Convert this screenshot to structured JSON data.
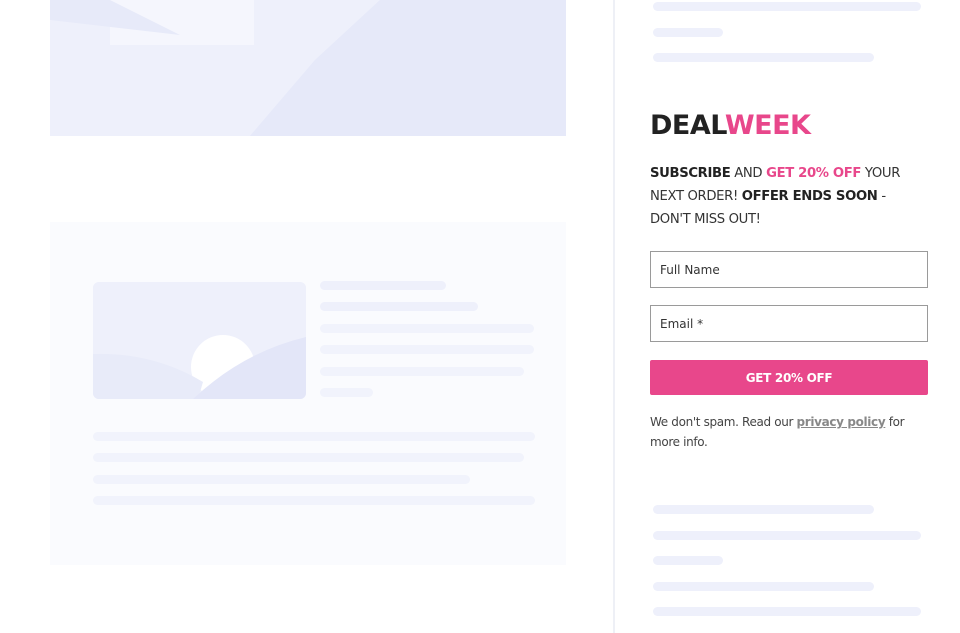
{
  "sidebar": {
    "brand": {
      "part1": "DEAL",
      "part2": "WEEK"
    },
    "promo": {
      "w1": "SUBSCRIBE",
      "w2": " AND ",
      "w3": "GET 20% OFF",
      "w4": " YOUR NEXT ORDER! ",
      "w5": "OFFER ENDS SOON",
      "w6": " - DON'T MISS OUT!"
    },
    "form": {
      "name_placeholder": "Full Name",
      "email_placeholder": "Email *",
      "submit_label": "GET 20% OFF"
    },
    "notice": {
      "before": "We don't spam. Read our ",
      "link": "privacy policy",
      "after": " for more info."
    }
  },
  "colors": {
    "accent": "#e8478b",
    "skeleton": "#eef0fb",
    "brand_dark": "#222222"
  }
}
